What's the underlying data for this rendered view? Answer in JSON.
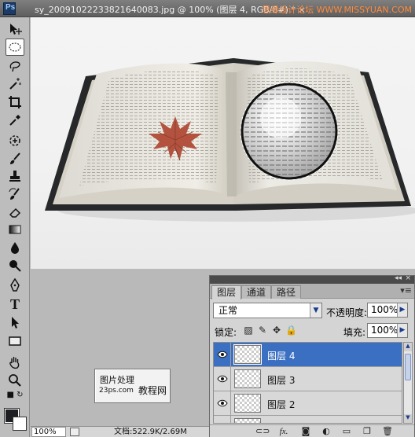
{
  "window": {
    "app_icon": "Ps",
    "title": "sy_20091022233821640083.jpg @ 100% (图层 4, RGB/8#) * ×",
    "watermark": "思缘设计论坛 WWW.MISSYUAN.COM"
  },
  "tools": [
    {
      "name": "move-tool-icon"
    },
    {
      "name": "elliptical-marquee-tool-icon",
      "active": true
    },
    {
      "name": "lasso-tool-icon"
    },
    {
      "name": "magic-wand-tool-icon"
    },
    {
      "name": "crop-tool-icon"
    },
    {
      "name": "eyedropper-tool-icon"
    },
    {
      "name": "healing-brush-tool-icon"
    },
    {
      "name": "brush-tool-icon"
    },
    {
      "name": "clone-stamp-tool-icon"
    },
    {
      "name": "history-brush-tool-icon"
    },
    {
      "name": "eraser-tool-icon"
    },
    {
      "name": "gradient-tool-icon"
    },
    {
      "name": "blur-tool-icon"
    },
    {
      "name": "dodge-tool-icon"
    },
    {
      "name": "pen-tool-icon"
    },
    {
      "name": "type-tool-icon"
    },
    {
      "name": "path-selection-tool-icon"
    },
    {
      "name": "rectangle-tool-icon"
    },
    {
      "name": "hand-tool-icon"
    },
    {
      "name": "zoom-tool-icon"
    }
  ],
  "colors": {
    "foreground": "#1e2024",
    "background": "#ffffff",
    "selection": "#3b6fc2"
  },
  "logo": {
    "line1": "图片处理",
    "line2": "23ps.com",
    "line3": "教程网"
  },
  "status": {
    "zoom": "100%",
    "doc": "文档:522.9K/2.69M"
  },
  "layers_panel": {
    "tabs": [
      "图层",
      "通道",
      "路径"
    ],
    "active_tab": 0,
    "blend_mode": "正常",
    "opacity_label": "不透明度:",
    "opacity": "100%",
    "lock_label": "锁定:",
    "fill_label": "填充:",
    "fill": "100%",
    "layers": [
      {
        "name": "图层 4",
        "selected": true,
        "visible": true
      },
      {
        "name": "图层 3",
        "selected": false,
        "visible": true
      },
      {
        "name": "图层 2",
        "selected": false,
        "visible": true
      }
    ]
  }
}
